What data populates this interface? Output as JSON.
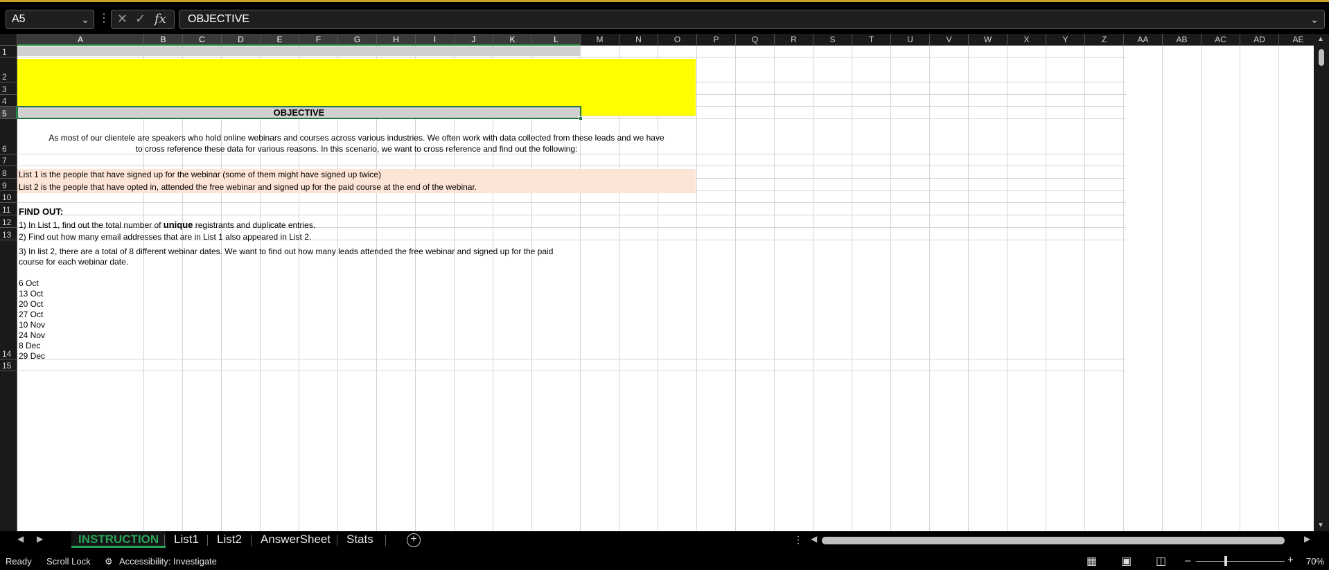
{
  "formula_bar": {
    "name_box": "A5",
    "formula": "OBJECTIVE",
    "fx_label": "fx"
  },
  "columns": [
    "A",
    "B",
    "C",
    "D",
    "E",
    "F",
    "G",
    "H",
    "I",
    "J",
    "K",
    "L",
    "M",
    "N",
    "O",
    "P",
    "Q",
    "R",
    "S",
    "T",
    "U",
    "V",
    "W",
    "X",
    "Y",
    "Z",
    "AA",
    "AB",
    "AC",
    "AD",
    "AE"
  ],
  "rows": [
    "1",
    "2",
    "3",
    "4",
    "5",
    "6",
    "7",
    "8",
    "9",
    "10",
    "11",
    "12",
    "13",
    "14",
    "15"
  ],
  "cells": {
    "objective_header": "OBJECTIVE",
    "intro_line1": "As most of our clientele are speakers who hold online webinars and courses across various industries. We often work with data collected from these leads and we have",
    "intro_line2": "to cross reference these data for various reasons. In this scenario, we want to cross reference and find out the following:",
    "list1_desc": "List 1 is the people that have signed up for the webinar (some of them might have signed up twice)",
    "list2_desc": "List 2 is the people that have opted in, attended the free webinar and signed up for the paid course at the end of the webinar.",
    "find_out": "FIND OUT:",
    "q1_pre": "1) In List 1, find out the total number of ",
    "q1_bold": "unique",
    "q1_post": " registrants and duplicate entries.",
    "q2": "2) Find out how many email addresses that are in List 1 also appeared in List 2.",
    "q3_line1": "3) In list 2, there are a total of 8 different webinar dates. We want to find out how many leads attended the free webinar and signed up for the paid",
    "q3_line2": "course for each webinar date.",
    "dates": [
      "6 Oct",
      "13 Oct",
      "20 Oct",
      "27 Oct",
      "10 Nov",
      "24 Nov",
      "8 Dec",
      "29 Dec"
    ]
  },
  "sheet_tabs": [
    {
      "label": "INSTRUCTION",
      "active": true
    },
    {
      "label": "List1",
      "active": false
    },
    {
      "label": "List2",
      "active": false
    },
    {
      "label": "AnswerSheet",
      "active": false
    },
    {
      "label": "Stats",
      "active": false
    }
  ],
  "status_bar": {
    "ready": "Ready",
    "scroll_lock": "Scroll Lock",
    "accessibility": "Accessibility: Investigate",
    "zoom": "70%",
    "zoom_percent": 70
  },
  "colors": {
    "yellow_fill": "#ffff00",
    "gray_fill": "#d0d0d0",
    "peach_fill": "#fce4d6",
    "selection": "#217346",
    "active_tab": "#2aa35a"
  }
}
